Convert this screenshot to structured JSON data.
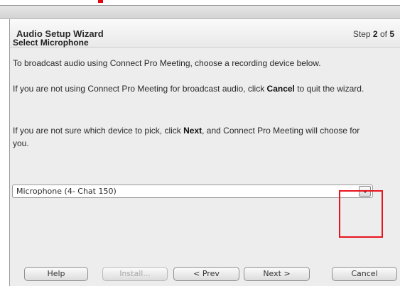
{
  "dialog": {
    "title": "Audio Setup Wizard",
    "step_prefix": "Step",
    "step_current": "2",
    "step_of": "of",
    "step_total": "5"
  },
  "content": {
    "heading": "Select Microphone",
    "paragraph1": "To broadcast audio using Connect Pro Meeting, choose a recording device below.",
    "paragraph2_pre": "If you are not using Connect Pro Meeting for broadcast audio, click ",
    "paragraph2_bold": "Cancel",
    "paragraph2_post": " to quit the wizard.",
    "paragraph3_pre": "If you are not sure which device to pick, click ",
    "paragraph3_bold": "Next",
    "paragraph3_post": ", and Connect Pro Meeting will choose for you."
  },
  "device_select": {
    "value": "Microphone (4- Chat 150)",
    "icon": "chevron-down-icon"
  },
  "buttons": {
    "help": "Help",
    "install": "Install...",
    "prev": "< Prev",
    "next": "Next >",
    "cancel": "Cancel"
  },
  "colors": {
    "highlight": "#e8141e",
    "dialog_bg": "#ededed"
  }
}
